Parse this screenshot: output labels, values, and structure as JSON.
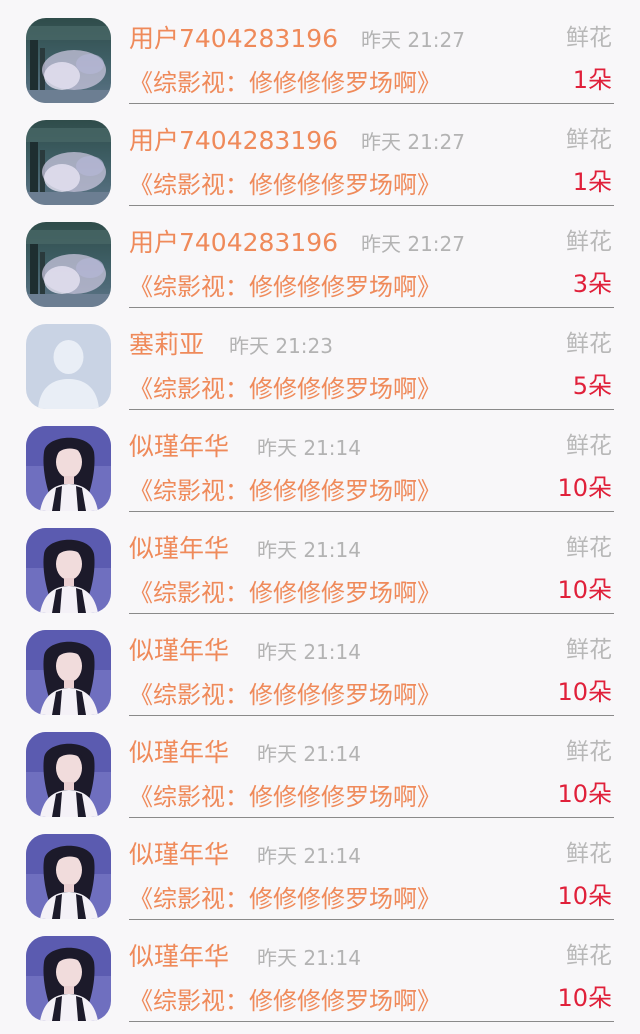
{
  "gifts": [
    {
      "user": "用户7404283196",
      "time": "昨天 21:27",
      "gift_label": "鲜花",
      "book": "《综影视：修修修修罗场啊》",
      "count": "1朵",
      "avatar": "landscape-photo"
    },
    {
      "user": "用户7404283196",
      "time": "昨天 21:27",
      "gift_label": "鲜花",
      "book": "《综影视：修修修修罗场啊》",
      "count": "1朵",
      "avatar": "landscape-photo"
    },
    {
      "user": "用户7404283196",
      "time": "昨天 21:27",
      "gift_label": "鲜花",
      "book": "《综影视：修修修修罗场啊》",
      "count": "3朵",
      "avatar": "landscape-photo"
    },
    {
      "user": "塞莉亚",
      "time": "昨天 21:23",
      "gift_label": "鲜花",
      "book": "《综影视：修修修修罗场啊》",
      "count": "5朵",
      "avatar": "default-silhouette"
    },
    {
      "user": "似瑾年华",
      "time": "昨天 21:14",
      "gift_label": "鲜花",
      "book": "《综影视：修修修修罗场啊》",
      "count": "10朵",
      "avatar": "portrait-photo"
    },
    {
      "user": "似瑾年华",
      "time": "昨天 21:14",
      "gift_label": "鲜花",
      "book": "《综影视：修修修修罗场啊》",
      "count": "10朵",
      "avatar": "portrait-photo"
    },
    {
      "user": "似瑾年华",
      "time": "昨天 21:14",
      "gift_label": "鲜花",
      "book": "《综影视：修修修修罗场啊》",
      "count": "10朵",
      "avatar": "portrait-photo"
    },
    {
      "user": "似瑾年华",
      "time": "昨天 21:14",
      "gift_label": "鲜花",
      "book": "《综影视：修修修修罗场啊》",
      "count": "10朵",
      "avatar": "portrait-photo"
    },
    {
      "user": "似瑾年华",
      "time": "昨天 21:14",
      "gift_label": "鲜花",
      "book": "《综影视：修修修修罗场啊》",
      "count": "10朵",
      "avatar": "portrait-photo"
    },
    {
      "user": "似瑾年华",
      "time": "昨天 21:14",
      "gift_label": "鲜花",
      "book": "《综影视：修修修修罗场啊》",
      "count": "10朵",
      "avatar": "portrait-photo"
    }
  ],
  "colors": {
    "username": "#ef8a5a",
    "count": "#e0203a",
    "muted": "#b3b3b3",
    "background": "#f8f7f9"
  }
}
